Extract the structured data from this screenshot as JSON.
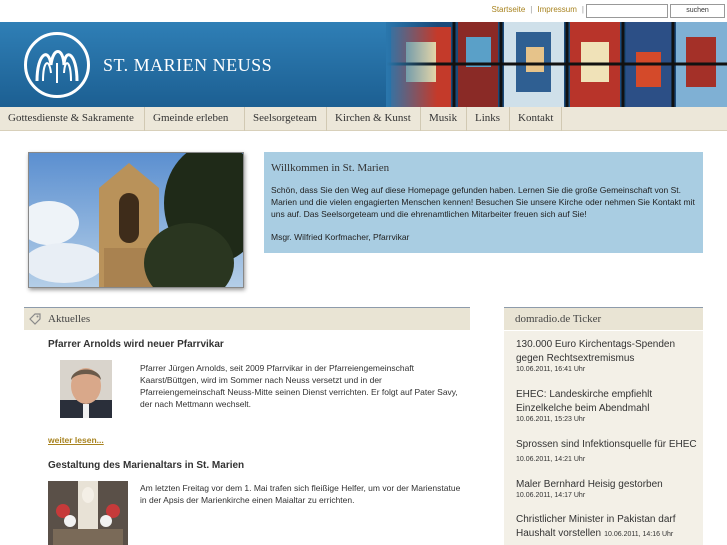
{
  "top_links": [
    "Startseite",
    "Impressum"
  ],
  "search": {
    "placeholder": "",
    "button": "suchen"
  },
  "site": {
    "title": "ST. MARIEN NEUSS"
  },
  "nav": [
    {
      "label": "Gottesdienste & Sakramente"
    },
    {
      "label": "Gmeinde erleben"
    },
    {
      "label": "Seelsorgeteam"
    },
    {
      "label": "Kirchen & Kunst"
    },
    {
      "label": "Musik"
    },
    {
      "label": "Links"
    },
    {
      "label": "Kontakt"
    }
  ],
  "welcome": {
    "title": "Willkommen in St. Marien",
    "text": "Schön, dass Sie den Weg auf diese Homepage gefunden haben. Lernen Sie die große Gemeinschaft von St. Marien und die vielen engagierten Menschen kennen! Besuchen Sie unsere Kirche oder nehmen Sie Kontakt mit uns auf. Das Seelsorgeteam und die ehrenamtlichen Mitarbeiter freuen sich auf Sie!",
    "signature": "Msgr. Wilfried Korfmacher, Pfarrvikar"
  },
  "news": {
    "header": "Aktuelles",
    "items": [
      {
        "title": "Pfarrer Arnolds wird neuer Pfarrvikar",
        "text": "Pfarrer Jürgen Arnolds, seit 2009 Pfarrvikar in der Pfarreiengemeinschaft Kaarst/Büttgen, wird im Sommer nach Neuss versetzt und in der Pfarreiengemeinschaft Neuss-Mitte seinen Dienst verrichten. Er folgt auf Pater Savy, der nach Mettmann wechselt.",
        "more": "weiter lesen..."
      },
      {
        "title": "Gestaltung des Marienaltars in St. Marien",
        "text": "Am letzten Freitag vor dem 1. Mai trafen sich fleißige Helfer, um vor der Marienstatue in der Apsis der Marienkirche einen Maialtar zu errichten."
      }
    ]
  },
  "ticker": {
    "header": "domradio.de Ticker",
    "items": [
      {
        "title": "130.000 Euro Kirchentags-Spenden gegen Rechtsextremismus",
        "date": "10.06.2011, 16:41 Uhr"
      },
      {
        "title": "EHEC: Landeskirche empfiehlt Einzelkelche beim Abendmahl",
        "date": "10.06.2011, 15:23 Uhr"
      },
      {
        "title": "Sprossen sind Infektionsquelle für EHEC",
        "date": "10.06.2011, 14:21 Uhr"
      },
      {
        "title": "Maler Bernhard Heisig gestorben",
        "date": "10.06.2011, 14:17 Uhr"
      },
      {
        "title": "Christlicher Minister in Pakistan darf Haushalt vorstellen",
        "date": "10.06.2011, 14:16 Uhr"
      }
    ]
  },
  "colors": {
    "header_blue": "#1c5f92",
    "nav_bg": "#ece7d9",
    "welcome_bg": "#a9cde2",
    "link_gold": "#a8831f"
  }
}
